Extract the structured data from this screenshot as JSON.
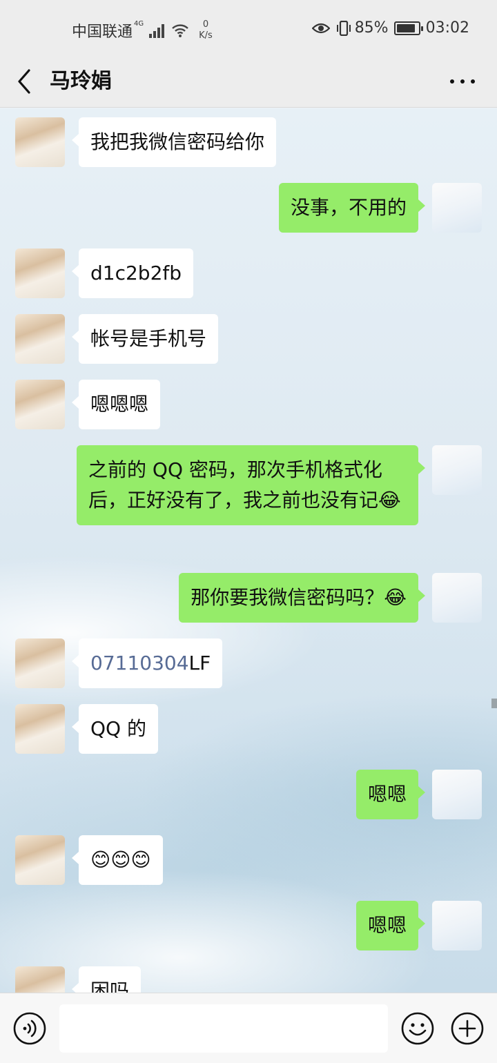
{
  "status_bar": {
    "carrier": "中国联通",
    "network_tag": "4G",
    "speed_value": "0",
    "speed_unit": "K/s",
    "battery": "85%",
    "battery_level": 0.85,
    "time": "03:02"
  },
  "header": {
    "title": "马玲娟"
  },
  "messages": [
    {
      "from": "peer",
      "text": "我把我微信密码给你"
    },
    {
      "from": "self",
      "text": "没事，不用的"
    },
    {
      "from": "peer",
      "text": "d1c2b2fb"
    },
    {
      "from": "peer",
      "text": "帐号是手机号"
    },
    {
      "from": "peer",
      "text": "嗯嗯嗯"
    },
    {
      "from": "self",
      "text": "之前的 QQ 密码，那次手机格式化后，正好没有了，我之前也没有记😂"
    },
    {
      "from": "self",
      "text": "那你要我微信密码吗？😂"
    },
    {
      "from": "peer",
      "text_prefix": "07110304",
      "text_suffix": "LF"
    },
    {
      "from": "peer",
      "text": "QQ 的"
    },
    {
      "from": "self",
      "text": "嗯嗯"
    },
    {
      "from": "peer",
      "text": "😊😊😊"
    },
    {
      "from": "self",
      "text": "嗯嗯"
    },
    {
      "from": "peer",
      "text": "困吗"
    }
  ],
  "input_bar": {
    "voice_icon": "voice-icon",
    "emoji_icon": "emoji-icon",
    "plus_icon": "plus-icon"
  },
  "colors": {
    "self_bubble": "#95ec69",
    "peer_bubble": "#ffffff",
    "bar_background": "#ededed",
    "link_number": "#576b95"
  }
}
